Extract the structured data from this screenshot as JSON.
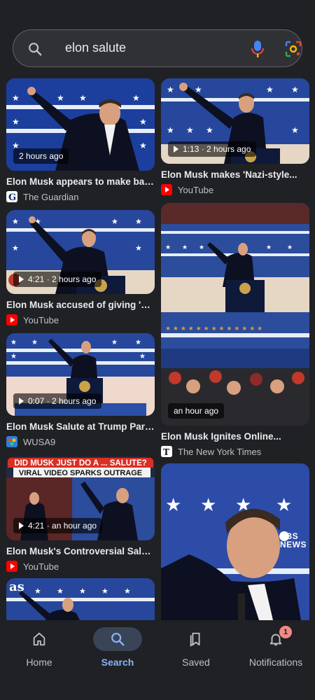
{
  "search": {
    "query": "elon salute"
  },
  "results_left": [
    {
      "badge": "2 hours ago",
      "video": false,
      "title": "Elon Musk appears to make bac...",
      "source": "The Guardian",
      "favicon": "guardian"
    },
    {
      "badge": "4:21 · 2 hours ago",
      "video": true,
      "title": "Elon Musk accused of giving 'Na...",
      "source": "YouTube",
      "favicon": "youtube"
    },
    {
      "badge": "0:07 · 2 hours ago",
      "video": true,
      "title": "Elon Musk Salute at Trump Parade",
      "source": "WUSA9",
      "favicon": "wusa"
    },
    {
      "badge": "4:21 · an hour ago",
      "video": true,
      "title": "Elon Musk's Controversial Salut...",
      "source": "YouTube",
      "favicon": "youtube",
      "overlay_line1": "DID MUSK JUST DO A ... SALUTE?",
      "overlay_line2": "VIRAL VIDEO SPARKS OUTRAGE"
    },
    {
      "logo": "as"
    }
  ],
  "results_right": [
    {
      "badge": "1:13 · 2 hours ago",
      "video": true,
      "title": "Elon Musk makes 'Nazi-style...",
      "source": "YouTube",
      "favicon": "youtube"
    },
    {
      "badge": "an hour ago",
      "video": false,
      "title": "Elon Musk Ignites Online...",
      "source": "The New York Times",
      "favicon": "nyt"
    },
    {
      "watermark": "PBS NEWS"
    }
  ],
  "nav": {
    "items": [
      {
        "label": "Home",
        "icon": "home-icon"
      },
      {
        "label": "Search",
        "icon": "search-icon",
        "active": true
      },
      {
        "label": "Saved",
        "icon": "bookmark-icon"
      },
      {
        "label": "Notifications",
        "icon": "bell-icon",
        "badge": "1"
      }
    ]
  },
  "colors": {
    "accent": "#8ab4f8",
    "background": "#202124",
    "youtube": "#ff0000",
    "banner_red": "#d93025"
  }
}
